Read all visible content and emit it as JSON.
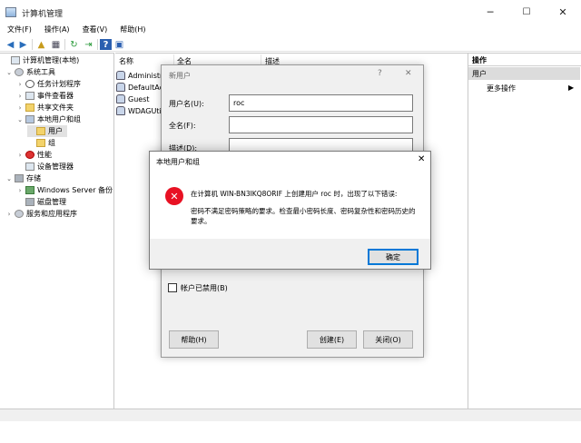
{
  "window": {
    "title": "计算机管理",
    "minimize_glyph": "─",
    "maximize_glyph": "☐",
    "close_glyph": "✕"
  },
  "menu": [
    "文件(F)",
    "操作(A)",
    "查看(V)",
    "帮助(H)"
  ],
  "toolbar": {
    "back_glyph": "◀",
    "forward_glyph": "▶",
    "up_glyph": "▲",
    "props_glyph": "▦",
    "refresh_glyph": "↻",
    "export_glyph": "⇥",
    "help_glyph": "?",
    "view_glyph": "▣"
  },
  "tree": [
    {
      "label": "计算机管理(本地)",
      "chevron": "",
      "icon": "computer-icon"
    },
    {
      "label": "系统工具",
      "chevron": "⌄",
      "icon": "tools-icon"
    },
    {
      "label": "任务计划程序",
      "chevron": "›",
      "icon": "clock-icon"
    },
    {
      "label": "事件查看器",
      "chevron": "›",
      "icon": "event-viewer-icon"
    },
    {
      "label": "共享文件夹",
      "chevron": "›",
      "icon": "shared-folder-icon"
    },
    {
      "label": "本地用户和组",
      "chevron": "⌄",
      "icon": "users-icon"
    },
    {
      "label": "用户",
      "chevron": "",
      "icon": "folder-icon"
    },
    {
      "label": "组",
      "chevron": "",
      "icon": "folder-icon"
    },
    {
      "label": "性能",
      "chevron": "›",
      "icon": "performance-icon"
    },
    {
      "label": "设备管理器",
      "chevron": "",
      "icon": "device-manager-icon"
    },
    {
      "label": "存储",
      "chevron": "⌄",
      "icon": "storage-icon"
    },
    {
      "label": "Windows Server 备份",
      "chevron": "›",
      "icon": "backup-icon"
    },
    {
      "label": "磁盘管理",
      "chevron": "",
      "icon": "disk-icon"
    },
    {
      "label": "服务和应用程序",
      "chevron": "›",
      "icon": "services-icon"
    }
  ],
  "list": {
    "columns": [
      "名称",
      "全名",
      "描述"
    ],
    "rows": [
      "Administrator",
      "DefaultAccount",
      "Guest",
      "WDAGUtilityAccount"
    ]
  },
  "actions": {
    "header": "操作",
    "selected": "用户",
    "more": "更多操作",
    "more_arrow": "▶"
  },
  "new_user_dialog": {
    "title": "新用户",
    "help_glyph": "?",
    "close_glyph": "✕",
    "username_label": "用户名(U):",
    "username_value": "roc",
    "fullname_label": "全名(F):",
    "fullname_value": "",
    "description_label": "描述(D):",
    "description_value": "",
    "disabled_label": "帐户已禁用(B)",
    "help_button": "帮助(H)",
    "create_button": "创建(E)",
    "close_button": "关闭(O)"
  },
  "error_dialog": {
    "title": "本地用户和组",
    "close_glyph": "✕",
    "icon_glyph": "✕",
    "message_line1": "在计算机 WIN-BN3IKQ8ORIF 上创建用户 roc 时，出现了以下错误:",
    "message_line2": "密码不满足密码策略的要求。检查最小密码长度、密码复杂性和密码历史的要求。",
    "ok_button": "确定"
  },
  "colors": {
    "accent": "#0078d7",
    "error": "#e81123",
    "selection": "#e2e2e2"
  }
}
